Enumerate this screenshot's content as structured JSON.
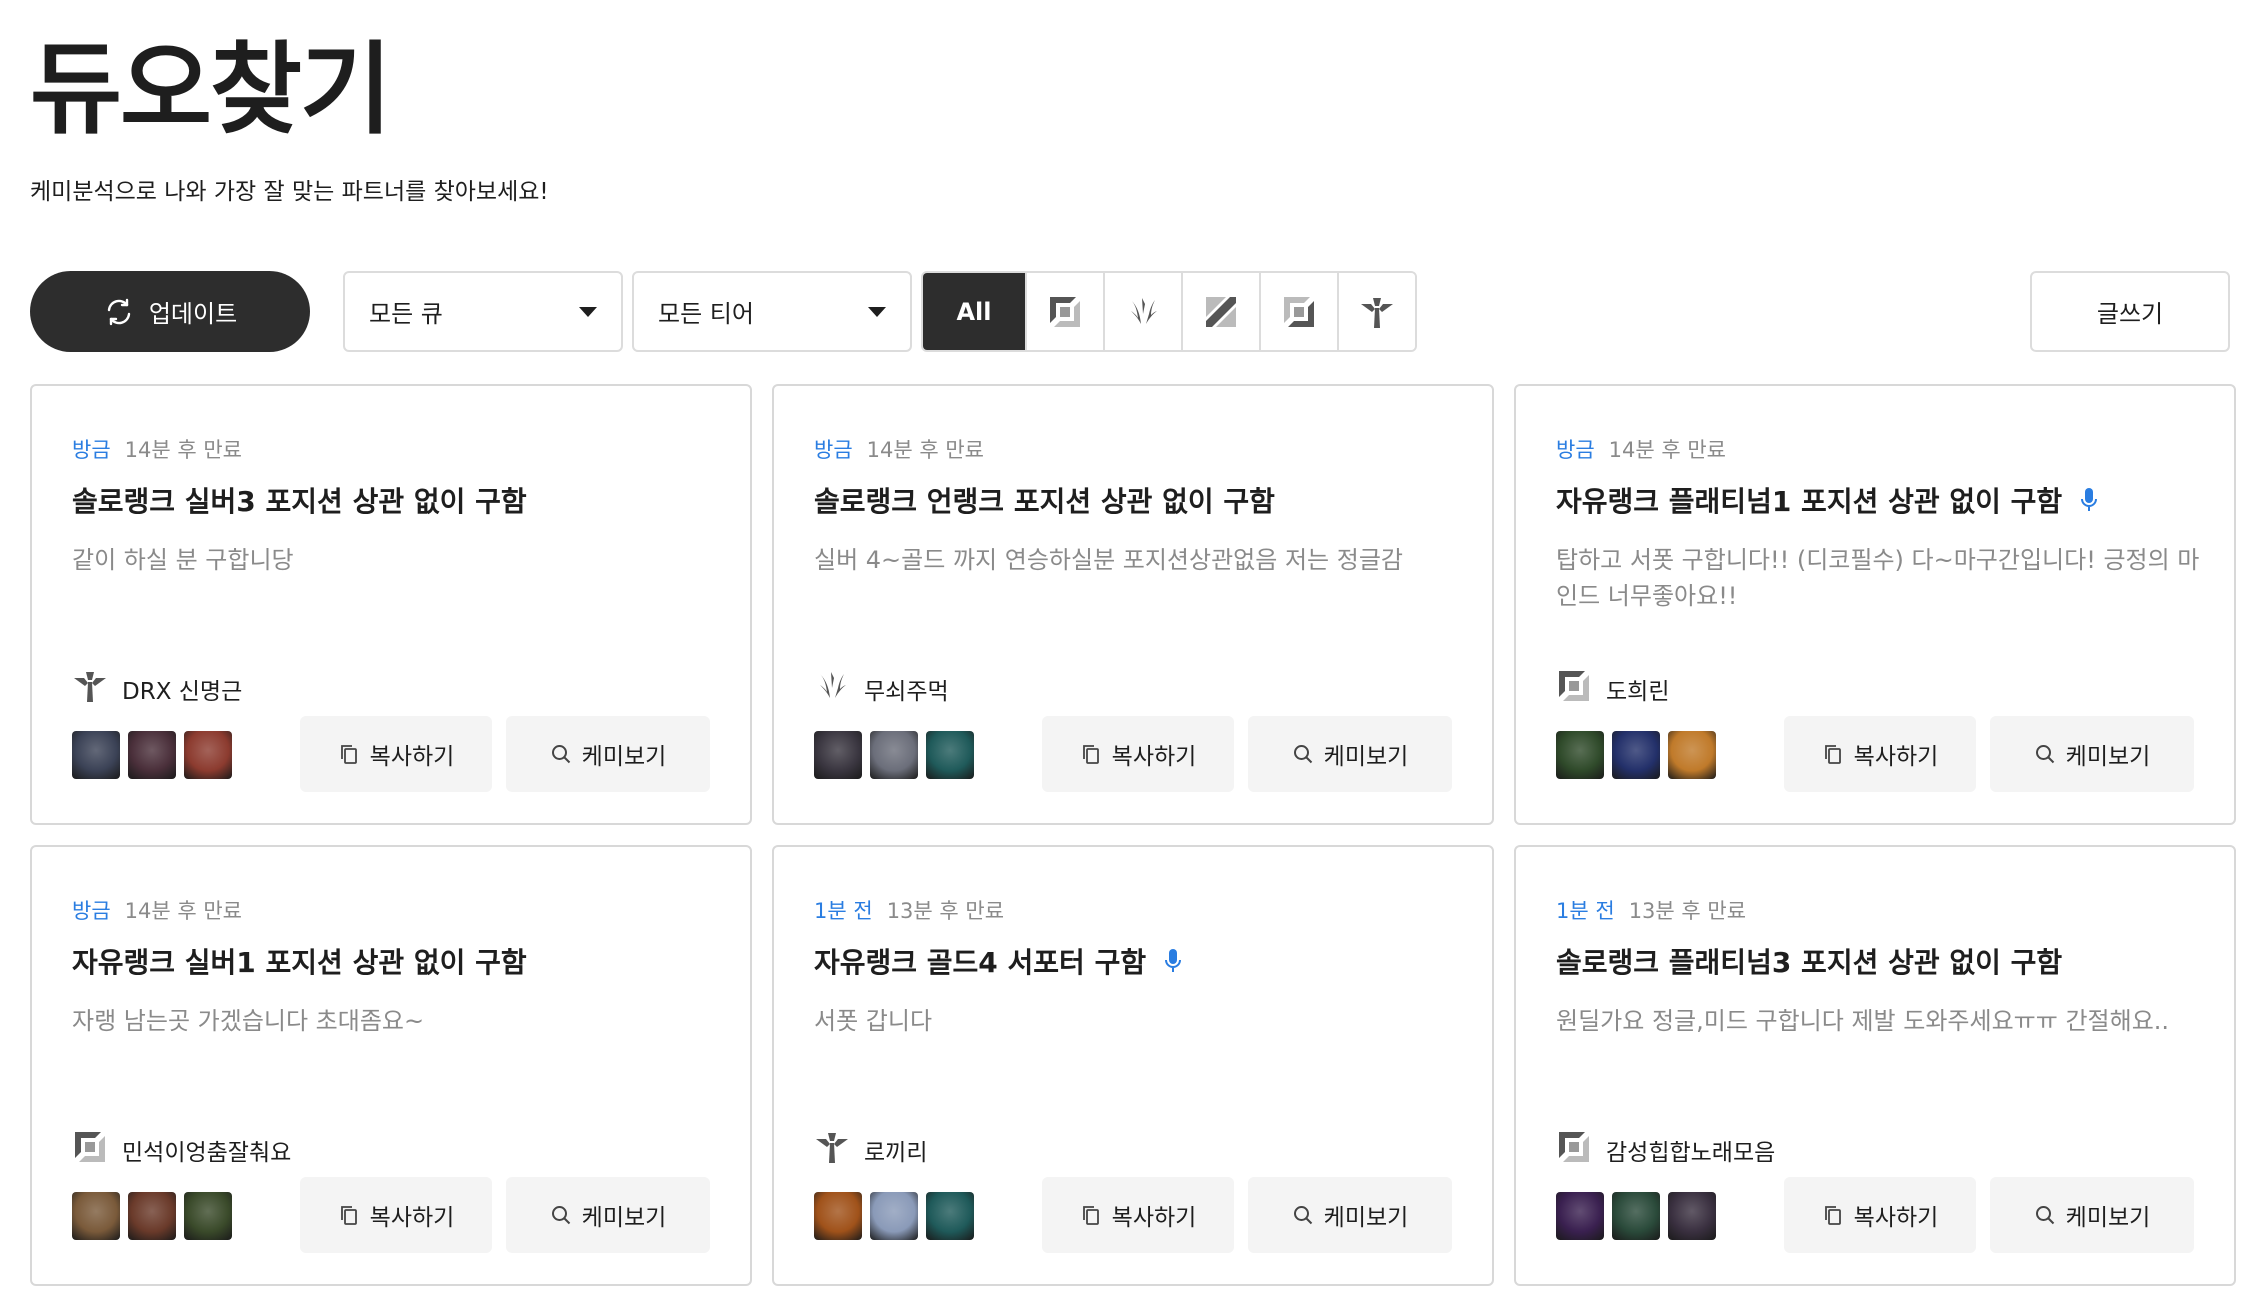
{
  "page": {
    "title": "듀오찾기",
    "subtitle": "케미분석으로 나와 가장 잘 맞는 파트너를 찾아보세요!"
  },
  "toolbar": {
    "update_label": "업데이트",
    "queue_select": "모든 큐",
    "tier_select": "모든 티어",
    "positions": [
      {
        "label": "All",
        "icon": "all",
        "active": true
      },
      {
        "label": "",
        "icon": "top-lane-icon"
      },
      {
        "label": "",
        "icon": "jungle-icon"
      },
      {
        "label": "",
        "icon": "mid-lane-icon"
      },
      {
        "label": "",
        "icon": "bottom-lane-icon"
      },
      {
        "label": "",
        "icon": "support-icon"
      }
    ],
    "write_label": "글쓰기"
  },
  "colors": {
    "accent_blue": "#2a7de1",
    "dark": "#2d2d2d",
    "muted": "#8a8a8a",
    "button_bg": "#f4f4f4"
  },
  "buttons": {
    "copy_label": "복사하기",
    "chem_label": "케미보기"
  },
  "cards": [
    {
      "time": "방금",
      "expire": "14분 후 만료",
      "title": "솔로랭크 실버3 포지션 상관 없이 구함",
      "mic": false,
      "desc": "같이 하실 분 구합니당",
      "user": "DRX 신명근",
      "position_icon": "support-icon",
      "champions": [
        "#3b4256",
        "#4a2f3a",
        "#8c3b2f"
      ]
    },
    {
      "time": "방금",
      "expire": "14분 후 만료",
      "title": "솔로랭크 언랭크 포지션 상관 없이 구함",
      "mic": false,
      "desc": "실버 4~골드 까지 연승하실분 포지션상관없음 저는 정글감",
      "user": "무쇠주먹",
      "position_icon": "jungle-icon",
      "champions": [
        "#3a3640",
        "#6b6e7a",
        "#1f5a5a"
      ]
    },
    {
      "time": "방금",
      "expire": "14분 후 만료",
      "title": "자유랭크 플래티넘1 포지션 상관 없이 구함",
      "mic": true,
      "desc": "탑하고 서폿 구합니다!! (디코필수) 다~마구간입니다! 긍정의 마인드 너무좋아요!!",
      "user": "도희린",
      "position_icon": "top-lane-icon",
      "champions": [
        "#2f4a2a",
        "#23306a",
        "#c07a2a"
      ]
    },
    {
      "time": "방금",
      "expire": "14분 후 만료",
      "title": "자유랭크 실버1 포지션 상관 없이 구함",
      "mic": false,
      "desc": "자랭 남는곳 가겠습니다 초대좀요~",
      "user": "민석이엉춤잘춰요",
      "position_icon": "top-lane-icon",
      "champions": [
        "#7a5a3a",
        "#6a3a2a",
        "#3a4a2a"
      ]
    },
    {
      "time": "1분 전",
      "expire": "13분 후 만료",
      "title": "자유랭크 골드4 서포터 구함",
      "mic": true,
      "desc": "서폿 갑니다",
      "user": "로끼리",
      "position_icon": "support-icon",
      "champions": [
        "#a0521a",
        "#8a9ab8",
        "#1f5a5a"
      ]
    },
    {
      "time": "1분 전",
      "expire": "13분 후 만료",
      "title": "솔로랭크 플래티넘3 포지션 상관 없이 구함",
      "mic": false,
      "desc": "원딜가요 정글,미드 구합니다 제발 도와주세요ㅠㅠ 간절해요..",
      "user": "감성힙합노래모음",
      "position_icon": "top-lane-icon",
      "champions": [
        "#3a2050",
        "#2a4a3a",
        "#3a3040"
      ]
    }
  ]
}
